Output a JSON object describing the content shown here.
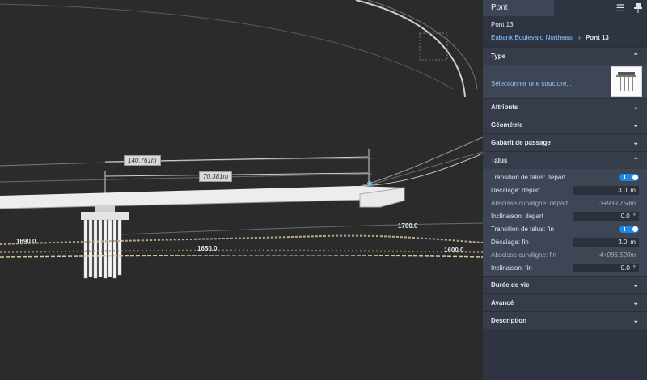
{
  "viewport": {
    "dimension_labels": {
      "long": "140.761m",
      "short": "70.381m"
    },
    "stations": {
      "s1690": "1690.0",
      "s1650": "1650.0",
      "s1700": "1700.0",
      "s1600": "1600.0"
    },
    "colors": {
      "background": "#2b2b2b",
      "road": "#f2f2f2",
      "terrain": "#c9b896"
    }
  },
  "panel": {
    "tab": "Pont",
    "icons": {
      "menu": "menu-icon",
      "pin": "pin-icon"
    },
    "title": "Pont 13",
    "breadcrumb": {
      "road": "Eubank Boulevard Northeast",
      "separator": "›",
      "current": "Pont 13"
    },
    "sections": {
      "type": {
        "label": "Type",
        "select_link": "Sélectionner une structure..."
      },
      "attributes": "Attributs",
      "geometry": "Géométrie",
      "clearance": "Gabarit de passage",
      "talus": "Talus",
      "lifespan": "Durée de vie",
      "advanced": "Avancé",
      "description": "Description"
    },
    "talus_rows": {
      "transition_start": {
        "label": "Transition de talus: départ",
        "on": true
      },
      "offset_start": {
        "label": "Décalage: départ",
        "value": "3.0",
        "unit": "m"
      },
      "station_start": {
        "label": "Abscisse curviligne: départ",
        "value": "3+939.758m"
      },
      "incline_start": {
        "label": "Inclinaison: départ",
        "value": "0.0",
        "unit": "°"
      },
      "transition_end": {
        "label": "Transition de talus: fin",
        "on": true
      },
      "offset_end": {
        "label": "Décalage: fin",
        "value": "3.0",
        "unit": "m"
      },
      "station_end": {
        "label": "Abscisse curviligne: fin",
        "value": "4+086.520m"
      },
      "incline_end": {
        "label": "Inclinaison: fin",
        "value": "0.0",
        "unit": "°"
      }
    },
    "colors": {
      "panel_bg": "#2e3441",
      "link": "#8ec7ff",
      "toggle": "#1e88e5"
    }
  }
}
